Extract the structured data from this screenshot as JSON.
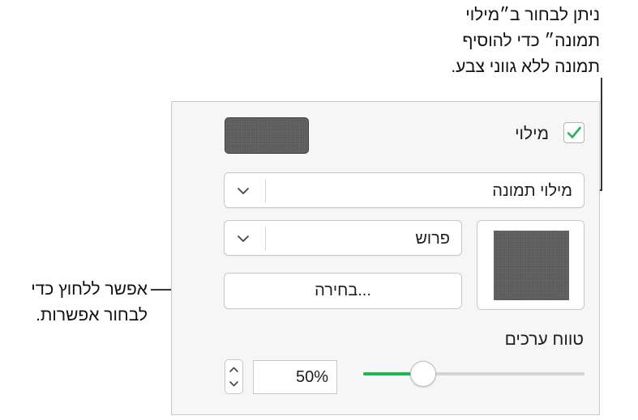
{
  "callouts": {
    "top_lines": [
      "ניתן לבחור ב״מילוי",
      "תמונה״ כדי להוסיף",
      "תמונה ללא גווני צבע."
    ],
    "left_lines": [
      "אפשר ללחוץ כדי",
      "לבחור אפשרות."
    ]
  },
  "panel": {
    "fill_label": "מילוי",
    "fill_checked": true,
    "fill_type": "מילוי תמונה",
    "scale": "פרוש",
    "choose_button": "בחירה...",
    "opacity_label": "טווח ערכים",
    "opacity_value": "50%",
    "opacity_fraction": 0.27
  },
  "colors": {
    "accent": "#25b35a",
    "swatch": "#5d5d5d"
  },
  "icons": [
    "checkmark-icon",
    "chevron-down-icon",
    "stepper-up-icon",
    "stepper-down-icon"
  ]
}
